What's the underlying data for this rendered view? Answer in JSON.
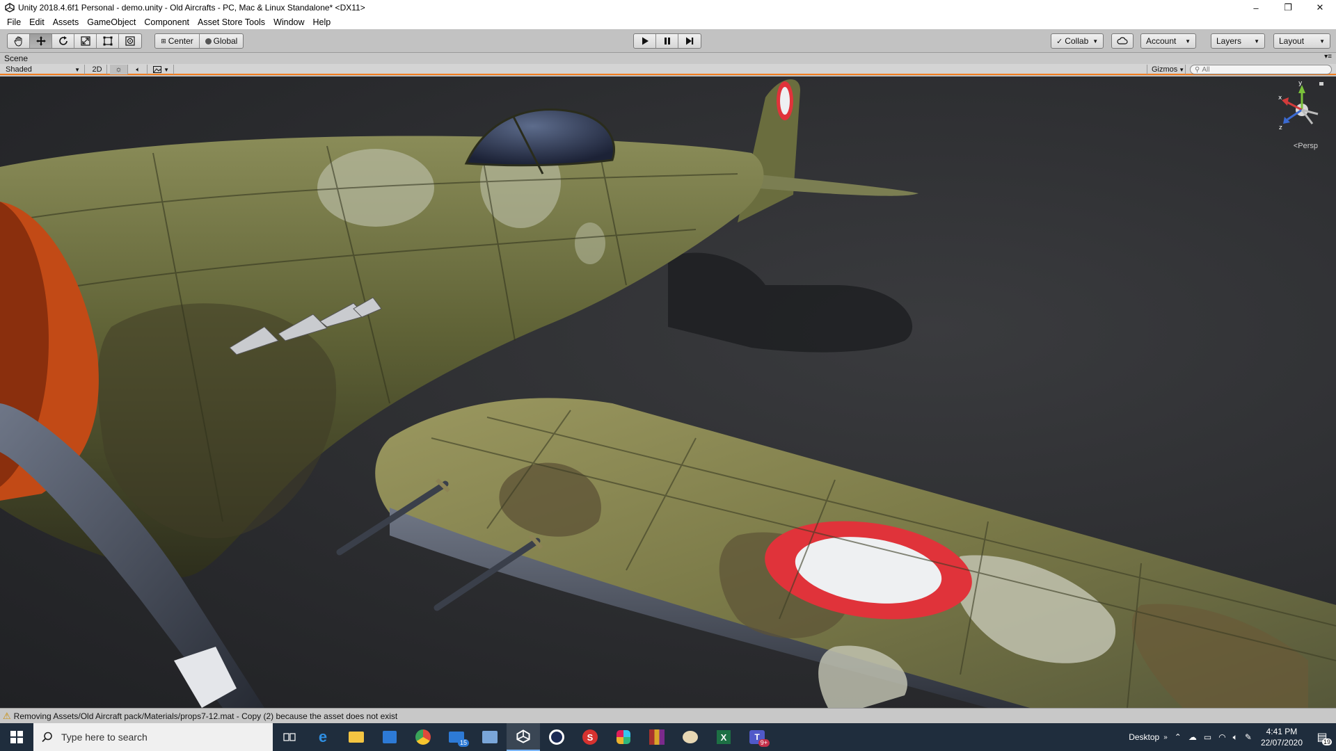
{
  "window": {
    "title": "Unity 2018.4.6f1 Personal - demo.unity - Old Aircrafts - PC, Mac & Linux Standalone* <DX11>",
    "controls": [
      "–",
      "❐",
      "✕"
    ]
  },
  "menu": [
    "File",
    "Edit",
    "Assets",
    "GameObject",
    "Component",
    "Asset Store Tools",
    "Window",
    "Help"
  ],
  "toolbar": {
    "tools": [
      "hand-tool",
      "move-tool",
      "rotate-tool",
      "scale-tool",
      "rect-tool",
      "transform-tool"
    ],
    "active_tool": "move-tool",
    "pivot_mode": "Center",
    "pivot_rotation": "Global",
    "play_controls": [
      "play",
      "pause",
      "step"
    ],
    "collab": "Collab",
    "account": "Account",
    "layers": "Layers",
    "layout": "Layout"
  },
  "scene": {
    "tab_title": "Scene",
    "shading_mode": "Shaded",
    "mode_2d": "2D",
    "gizmos": "Gizmos",
    "search_placeholder": "All",
    "projection": "Persp",
    "gizmo_axes": {
      "x": "x",
      "y": "y",
      "z": "z"
    }
  },
  "status": {
    "message": "Removing Assets/Old Aircraft pack/Materials/props7-12.mat - Copy (2) because the asset does not exist"
  },
  "taskbar": {
    "search_placeholder": "Type here to search",
    "apps": [
      {
        "name": "task-view",
        "badge": ""
      },
      {
        "name": "edge",
        "badge": ""
      },
      {
        "name": "file-explorer",
        "badge": ""
      },
      {
        "name": "store",
        "badge": ""
      },
      {
        "name": "chrome",
        "badge": ""
      },
      {
        "name": "mail",
        "badge": "15"
      },
      {
        "name": "remote-desktop",
        "badge": ""
      },
      {
        "name": "unity",
        "badge": ""
      },
      {
        "name": "cinema4d",
        "badge": ""
      },
      {
        "name": "substance",
        "badge": ""
      },
      {
        "name": "slack",
        "badge": ""
      },
      {
        "name": "winrar",
        "badge": ""
      },
      {
        "name": "paint",
        "badge": ""
      },
      {
        "name": "excel",
        "badge": ""
      },
      {
        "name": "teams",
        "badge": "9+"
      }
    ],
    "desktop_label": "Desktop",
    "time": "4:41 PM",
    "date": "22/07/2020",
    "notifications": "19"
  },
  "colors": {
    "accent": "#f07c1e",
    "camo_green": "#6b6e3c",
    "roundel_red": "#e0333a",
    "taskbar": "#1f2d3d"
  }
}
